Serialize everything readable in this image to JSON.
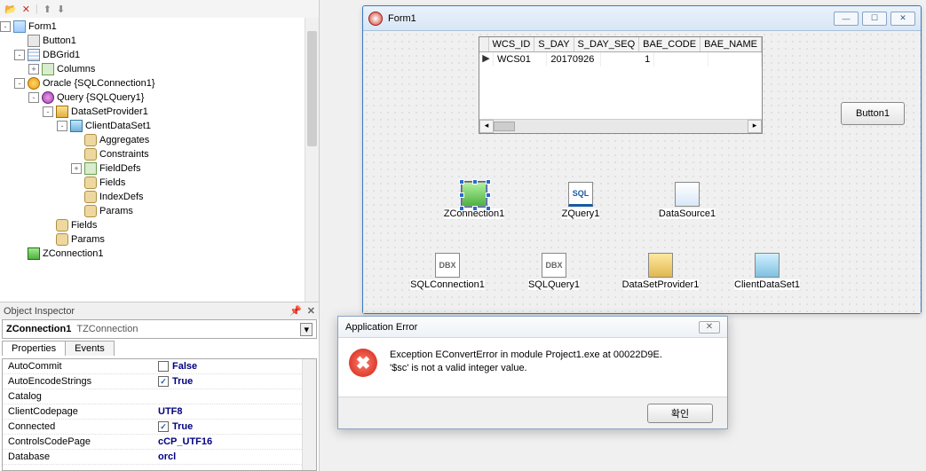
{
  "tree": {
    "root": "Form1",
    "items": [
      {
        "indent": 0,
        "exp": "-",
        "icon": "ic-form",
        "label": "Form1"
      },
      {
        "indent": 1,
        "exp": "",
        "icon": "ic-btn",
        "label": "Button1"
      },
      {
        "indent": 1,
        "exp": "-",
        "icon": "ic-grid",
        "label": "DBGrid1"
      },
      {
        "indent": 2,
        "exp": "+",
        "icon": "ic-field",
        "label": "Columns"
      },
      {
        "indent": 1,
        "exp": "-",
        "icon": "ic-db",
        "label": "Oracle {SQLConnection1}"
      },
      {
        "indent": 2,
        "exp": "-",
        "icon": "ic-query",
        "label": "Query {SQLQuery1}"
      },
      {
        "indent": 3,
        "exp": "-",
        "icon": "ic-dsp",
        "label": "DataSetProvider1"
      },
      {
        "indent": 4,
        "exp": "-",
        "icon": "ic-cds",
        "label": "ClientDataSet1"
      },
      {
        "indent": 5,
        "exp": "",
        "icon": "ic-leaf",
        "label": "Aggregates"
      },
      {
        "indent": 5,
        "exp": "",
        "icon": "ic-leaf",
        "label": "Constraints"
      },
      {
        "indent": 5,
        "exp": "+",
        "icon": "ic-field",
        "label": "FieldDefs"
      },
      {
        "indent": 5,
        "exp": "",
        "icon": "ic-leaf",
        "label": "Fields"
      },
      {
        "indent": 5,
        "exp": "",
        "icon": "ic-leaf",
        "label": "IndexDefs"
      },
      {
        "indent": 5,
        "exp": "",
        "icon": "ic-leaf",
        "label": "Params"
      },
      {
        "indent": 3,
        "exp": "",
        "icon": "ic-leaf",
        "label": "Fields"
      },
      {
        "indent": 3,
        "exp": "",
        "icon": "ic-leaf",
        "label": "Params"
      },
      {
        "indent": 1,
        "exp": "",
        "icon": "ic-zcon",
        "label": "ZConnection1"
      }
    ]
  },
  "inspector": {
    "title": "Object Inspector",
    "object_name": "ZConnection1",
    "object_class": "TZConnection",
    "tabs": {
      "props": "Properties",
      "events": "Events"
    },
    "props": [
      {
        "name": "AutoCommit",
        "chk": false,
        "val": "False"
      },
      {
        "name": "AutoEncodeStrings",
        "chk": true,
        "val": "True"
      },
      {
        "name": "Catalog",
        "val": ""
      },
      {
        "name": "ClientCodepage",
        "val": "UTF8"
      },
      {
        "name": "Connected",
        "chk": true,
        "val": "True"
      },
      {
        "name": "ControlsCodePage",
        "val": "cCP_UTF16"
      },
      {
        "name": "Database",
        "val": "orcl"
      }
    ]
  },
  "designer": {
    "title": "Form1",
    "grid": {
      "columns": [
        "WCS_ID",
        "S_DAY",
        "S_DAY_SEQ",
        "BAE_CODE",
        "BAE_NAME"
      ],
      "rows": [
        {
          "WCS_ID": "WCS01",
          "S_DAY": "20170926",
          "S_DAY_SEQ": "1",
          "BAE_CODE": "",
          "BAE_NAME": ""
        }
      ]
    },
    "button_label": "Button1",
    "components_row1": [
      {
        "label": "ZConnection1",
        "cls": "ci-zcon",
        "selected": true
      },
      {
        "label": "ZQuery1",
        "cls": "ci-zq"
      },
      {
        "label": "DataSource1",
        "cls": "ci-ds"
      }
    ],
    "components_row2": [
      {
        "label": "SQLConnection1",
        "cls": "ci-dbx"
      },
      {
        "label": "SQLQuery1",
        "cls": "ci-dbx"
      },
      {
        "label": "DataSetProvider1",
        "cls": "ci-dsp"
      },
      {
        "label": "ClientDataSet1",
        "cls": "ci-cds"
      }
    ]
  },
  "error": {
    "title": "Application Error",
    "line1": "Exception EConvertError in module Project1.exe at 00022D9E.",
    "line2": "'$sc' is not a valid integer value.",
    "ok": "확인"
  }
}
